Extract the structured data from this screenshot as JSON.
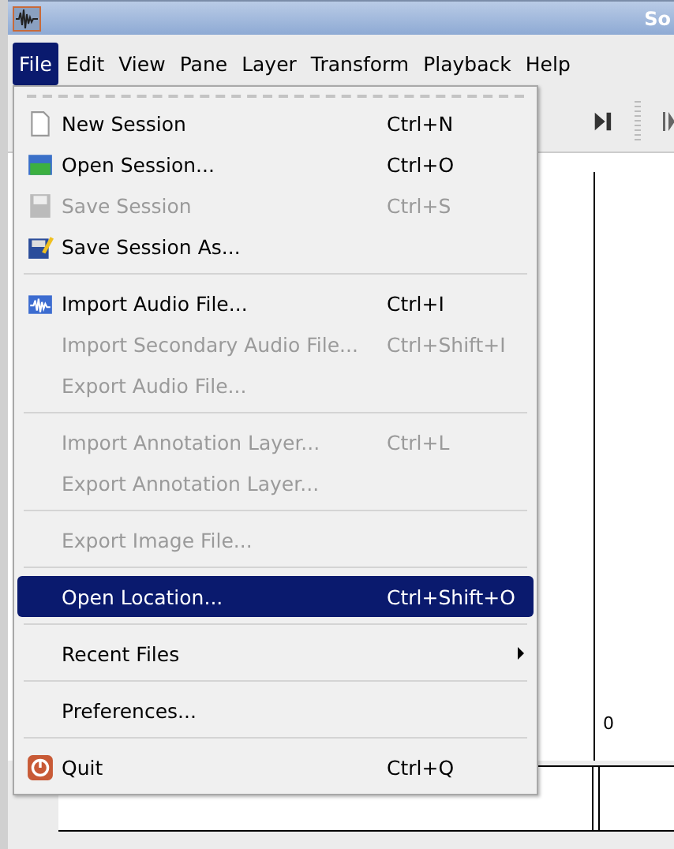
{
  "window": {
    "title": "So"
  },
  "menubar": [
    {
      "label": "File",
      "selected": true
    },
    {
      "label": "Edit",
      "selected": false
    },
    {
      "label": "View",
      "selected": false
    },
    {
      "label": "Pane",
      "selected": false
    },
    {
      "label": "Layer",
      "selected": false
    },
    {
      "label": "Transform",
      "selected": false
    },
    {
      "label": "Playback",
      "selected": false
    },
    {
      "label": "Help",
      "selected": false
    }
  ],
  "file_menu": [
    {
      "kind": "item",
      "label": "New Session",
      "shortcut": "Ctrl+N",
      "disabled": false,
      "selected": false
    },
    {
      "kind": "item",
      "label": "Open Session...",
      "shortcut": "Ctrl+O",
      "disabled": false,
      "selected": false
    },
    {
      "kind": "item",
      "label": "Save Session",
      "shortcut": "Ctrl+S",
      "disabled": true,
      "selected": false
    },
    {
      "kind": "item",
      "label": "Save Session As...",
      "disabled": false,
      "selected": false
    },
    {
      "kind": "separator"
    },
    {
      "kind": "item",
      "label": "Import Audio File...",
      "shortcut": "Ctrl+I",
      "disabled": false,
      "selected": false
    },
    {
      "kind": "item",
      "label": "Import Secondary Audio File...",
      "shortcut": "Ctrl+Shift+I",
      "disabled": true,
      "selected": false
    },
    {
      "kind": "item",
      "label": "Export Audio File...",
      "disabled": true,
      "selected": false
    },
    {
      "kind": "separator"
    },
    {
      "kind": "item",
      "label": "Import Annotation Layer...",
      "shortcut": "Ctrl+L",
      "disabled": true,
      "selected": false
    },
    {
      "kind": "item",
      "label": "Export Annotation Layer...",
      "disabled": true,
      "selected": false
    },
    {
      "kind": "separator"
    },
    {
      "kind": "item",
      "label": "Export Image File...",
      "disabled": true,
      "selected": false
    },
    {
      "kind": "separator"
    },
    {
      "kind": "item",
      "label": "Open Location...",
      "shortcut": "Ctrl+Shift+O",
      "disabled": false,
      "selected": true
    },
    {
      "kind": "separator"
    },
    {
      "kind": "submenu",
      "label": "Recent Files",
      "disabled": false,
      "selected": false
    },
    {
      "kind": "separator"
    },
    {
      "kind": "item",
      "label": "Preferences...",
      "disabled": false,
      "selected": false
    },
    {
      "kind": "separator"
    },
    {
      "kind": "item",
      "label": "Quit",
      "shortcut": "Ctrl+Q",
      "disabled": false,
      "selected": false
    }
  ],
  "pane": {
    "scale_label": "0"
  }
}
